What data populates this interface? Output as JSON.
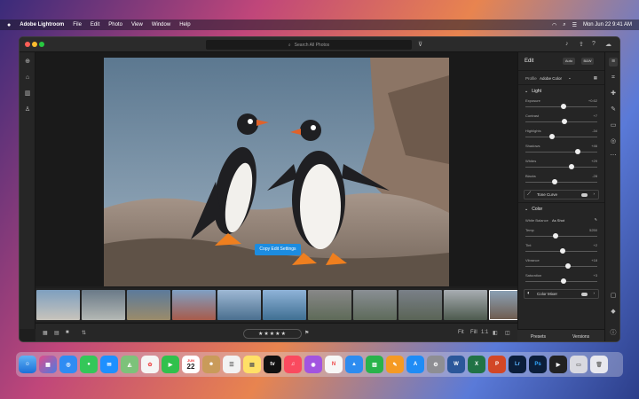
{
  "menubar": {
    "apple": "",
    "app_name": "Adobe Lightroom",
    "items": [
      "File",
      "Edit",
      "Photo",
      "View",
      "Window",
      "Help"
    ],
    "clock": "Mon Jun 22  9:41 AM"
  },
  "titlebar": {
    "search_placeholder": "Search All Photos"
  },
  "canvas": {
    "copy_edit_settings": "Copy Edit Settings"
  },
  "bottombar": {
    "stars": "★★★★★",
    "zoom_fit": "Fit",
    "zoom_fill": "Fill",
    "zoom_1to1": "1:1"
  },
  "edit_panel": {
    "title": "Edit",
    "auto": "Auto",
    "bw": "B&W",
    "profile_label": "Profile",
    "profile_value": "Adobe Color",
    "light": {
      "title": "Light",
      "sliders": [
        {
          "label": "Exposure",
          "value": "+0.62",
          "pos": 0.52
        },
        {
          "label": "Contrast",
          "value": "+7",
          "pos": 0.54
        },
        {
          "label": "Highlights",
          "value": "-34",
          "pos": 0.36
        },
        {
          "label": "Shadows",
          "value": "+46",
          "pos": 0.72
        },
        {
          "label": "Whites",
          "value": "+29",
          "pos": 0.63
        },
        {
          "label": "Blacks",
          "value": "-28",
          "pos": 0.4
        }
      ],
      "tone_curve": "Tone Curve"
    },
    "color": {
      "title": "Color",
      "white_balance_label": "White Balance",
      "white_balance_value": "As Shot",
      "sliders": [
        {
          "label": "Temp",
          "value": "5250",
          "pos": 0.42
        },
        {
          "label": "Tint",
          "value": "+2",
          "pos": 0.51
        },
        {
          "label": "Vibrance",
          "value": "+18",
          "pos": 0.59
        },
        {
          "label": "Saturation",
          "value": "+3",
          "pos": 0.52
        }
      ],
      "color_mixer": "Color Mixer"
    }
  },
  "presets_bar": {
    "presets": "Presets",
    "versions": "Versions"
  },
  "dock": {
    "calendar_month": "JUN",
    "calendar_day": "22",
    "word": "W",
    "excel": "X",
    "powerpoint": "P",
    "lightroom": "Lr",
    "photoshop": "Ps",
    "appletv": "tv"
  },
  "colors": {
    "accent": "#1c8ce0"
  }
}
